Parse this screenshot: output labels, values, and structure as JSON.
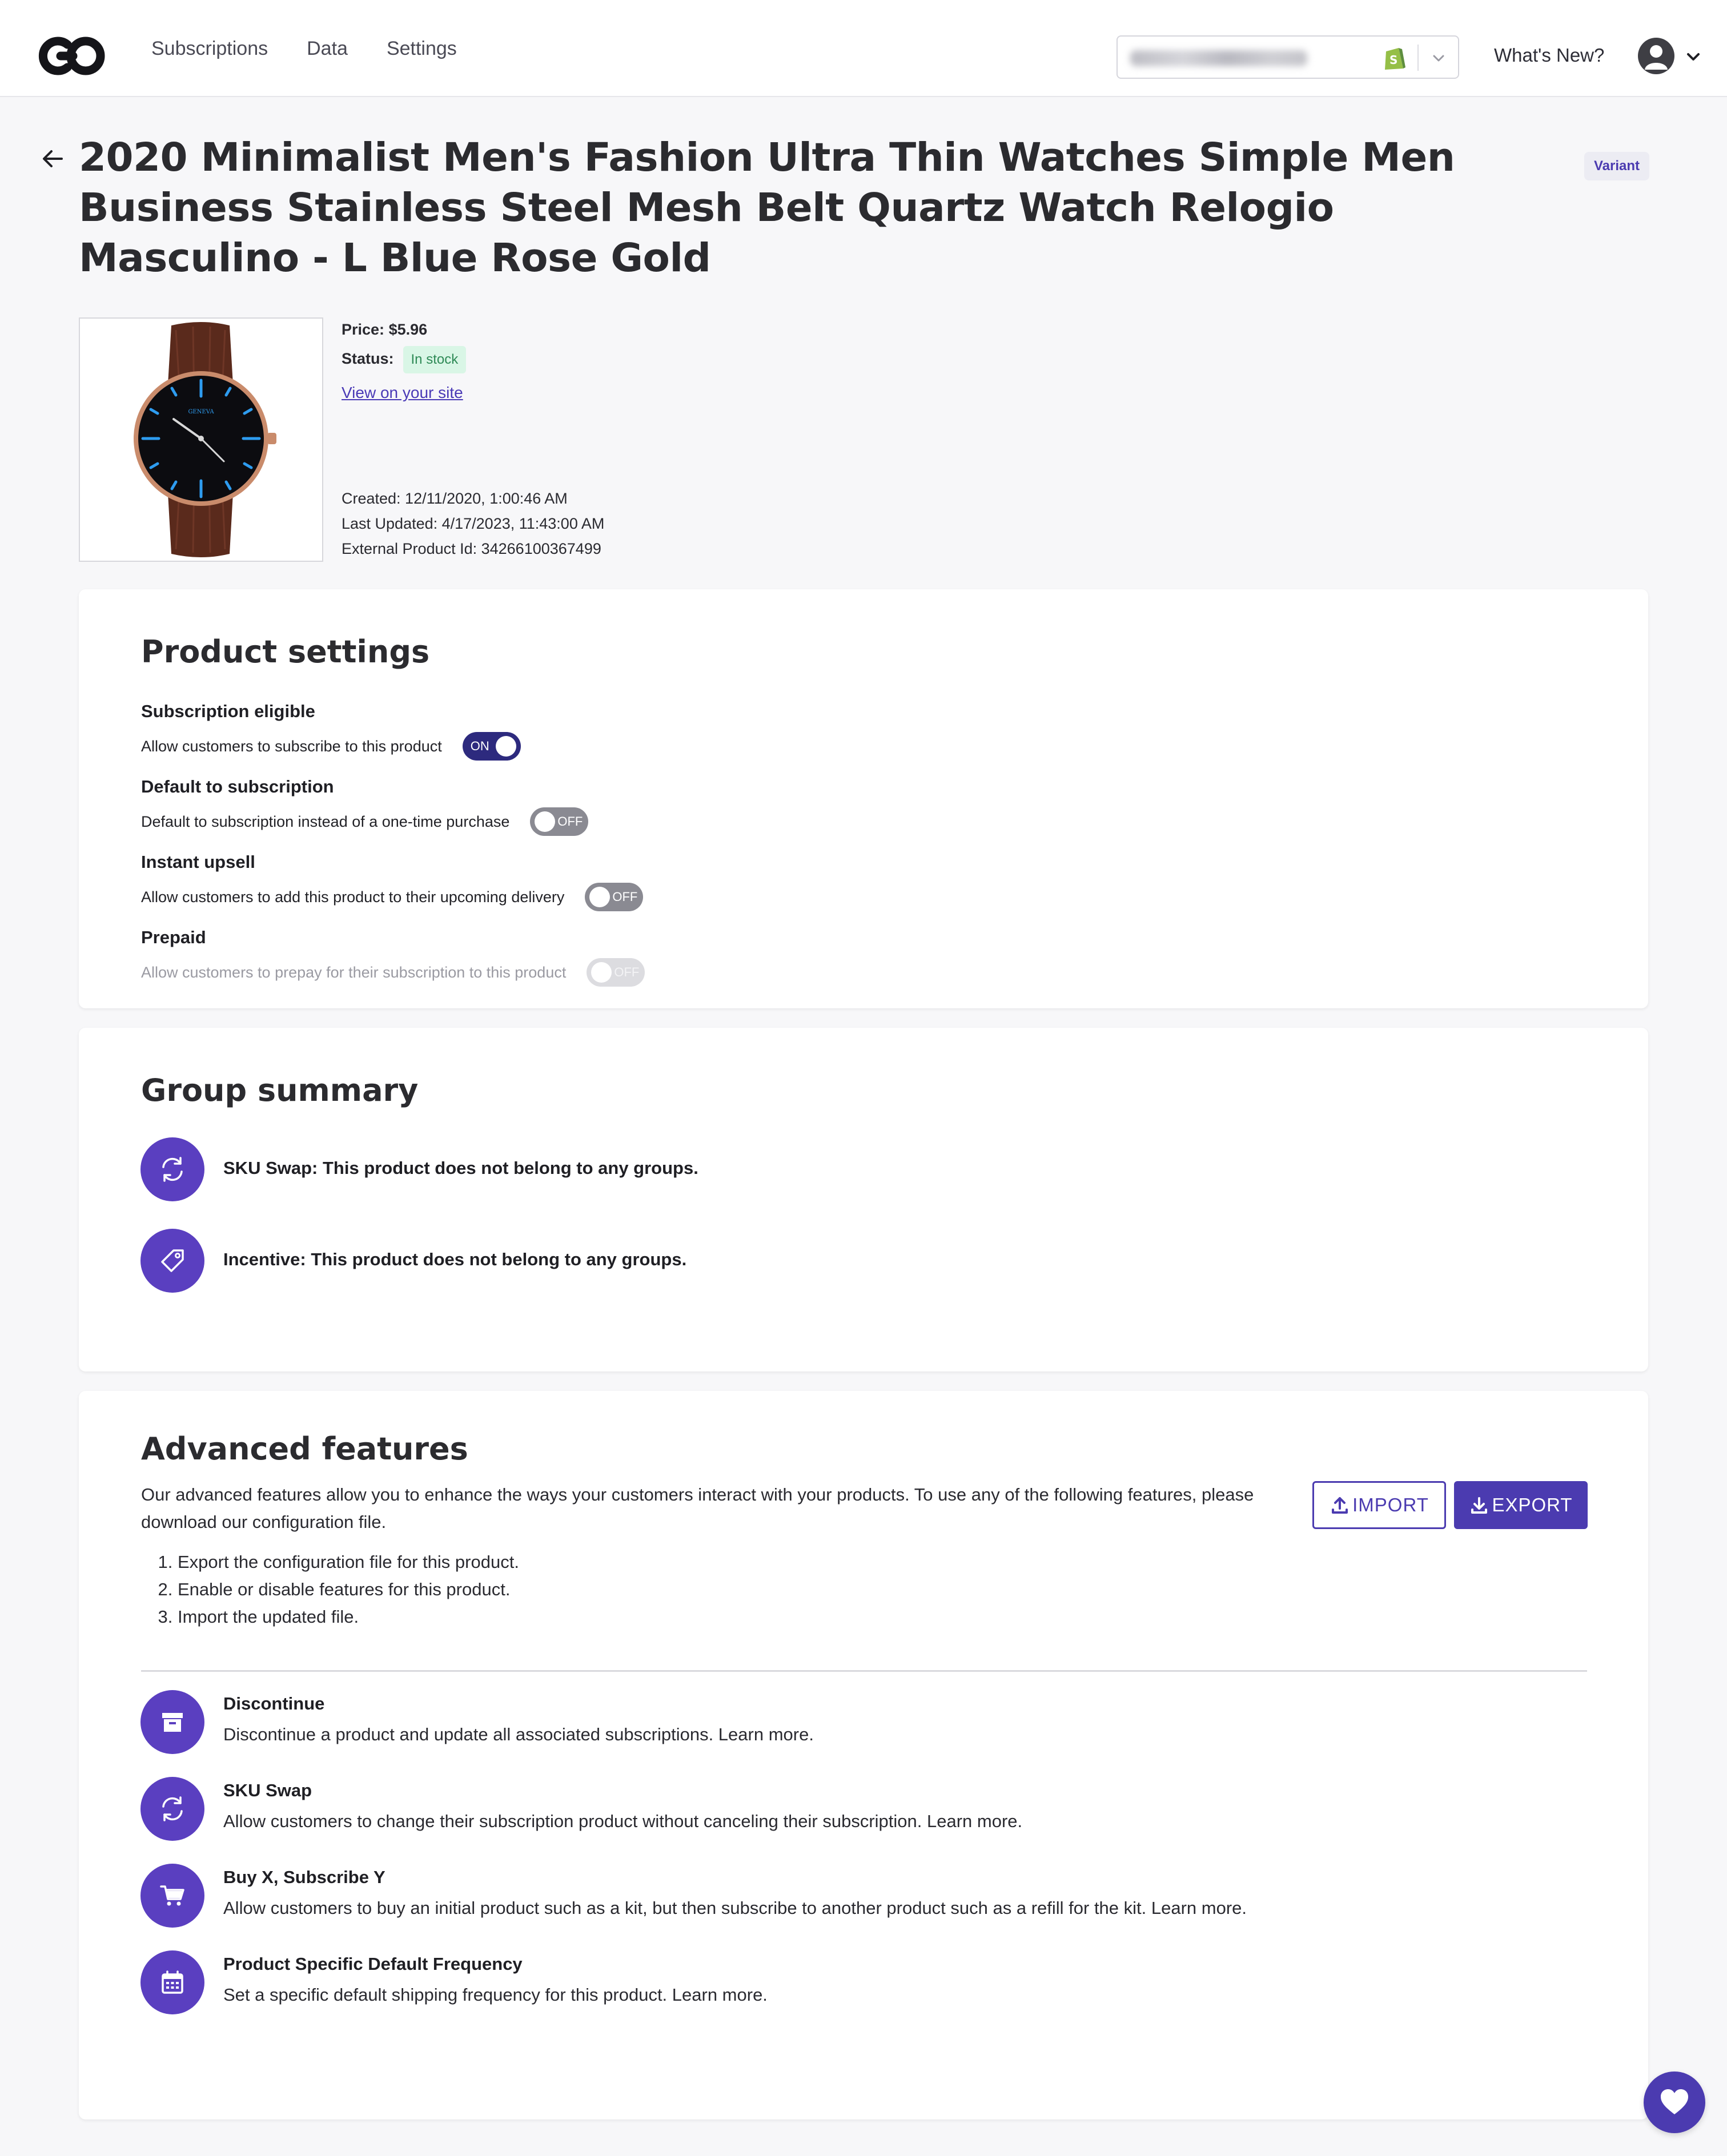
{
  "nav": {
    "items": [
      {
        "label": "Subscriptions"
      },
      {
        "label": "Data"
      },
      {
        "label": "Settings"
      }
    ],
    "whats_new": "What's New?"
  },
  "product": {
    "title": "2020 Minimalist Men's Fashion Ultra Thin Watches Simple Men Business Stainless Steel Mesh Belt Quartz Watch Relogio Masculino - L Blue Rose Gold",
    "badge": "Variant",
    "price_label": "Price:",
    "price_value": "$5.96",
    "status_label": "Status:",
    "status_value": "In stock",
    "view_link": "View on your site",
    "created": "Created: 12/11/2020, 1:00:46 AM",
    "last_updated": "Last Updated: 4/17/2023, 11:43:00 AM",
    "external_id": "External Product Id: 34266100367499",
    "watch_brand": "GENEVA"
  },
  "product_settings": {
    "heading": "Product settings",
    "items": [
      {
        "title": "Subscription eligible",
        "desc": "Allow customers to subscribe to this product",
        "state": "ON"
      },
      {
        "title": "Default to subscription",
        "desc": "Default to subscription instead of a one-time purchase",
        "state": "OFF"
      },
      {
        "title": "Instant upsell",
        "desc": "Allow customers to add this product to their upcoming delivery",
        "state": "OFF"
      },
      {
        "title": "Prepaid",
        "desc": "Allow customers to prepay for their subscription to this product",
        "state": "OFF"
      }
    ]
  },
  "group_summary": {
    "heading": "Group summary",
    "items": [
      {
        "text": "SKU Swap: This product does not belong to any groups.",
        "icon": "refresh-icon"
      },
      {
        "text": "Incentive: This product does not belong to any groups.",
        "icon": "tag-icon"
      }
    ]
  },
  "advanced": {
    "heading": "Advanced features",
    "description": "Our advanced features allow you to enhance the ways your customers interact with your products. To use any of the following features, please download our configuration file.",
    "steps": [
      "Export the configuration file for this product.",
      "Enable or disable features for this product.",
      "Import the updated file."
    ],
    "import_label": "IMPORT",
    "export_label": "EXPORT",
    "features": [
      {
        "title": "Discontinue",
        "desc": "Discontinue a product and update all associated subscriptions. Learn more.",
        "icon": "archive-icon"
      },
      {
        "title": "SKU Swap",
        "desc": "Allow customers to change their subscription product without canceling their subscription. Learn more.",
        "icon": "refresh-icon"
      },
      {
        "title": "Buy X, Subscribe Y",
        "desc": "Allow customers to buy an initial product such as a kit, but then subscribe to another product such as a refill for the kit. Learn more.",
        "icon": "cart-icon"
      },
      {
        "title": "Product Specific Default Frequency",
        "desc": "Set a specific default shipping frequency for this product. Learn more.",
        "icon": "calendar-icon"
      }
    ]
  },
  "colors": {
    "accent": "#4b3bb0",
    "icon_circle": "#5a3fc0",
    "toggle_on": "#2d2a7e",
    "toggle_off": "#8a8a92",
    "status_bg": "#d9f6e6",
    "status_text": "#2e8a56"
  }
}
